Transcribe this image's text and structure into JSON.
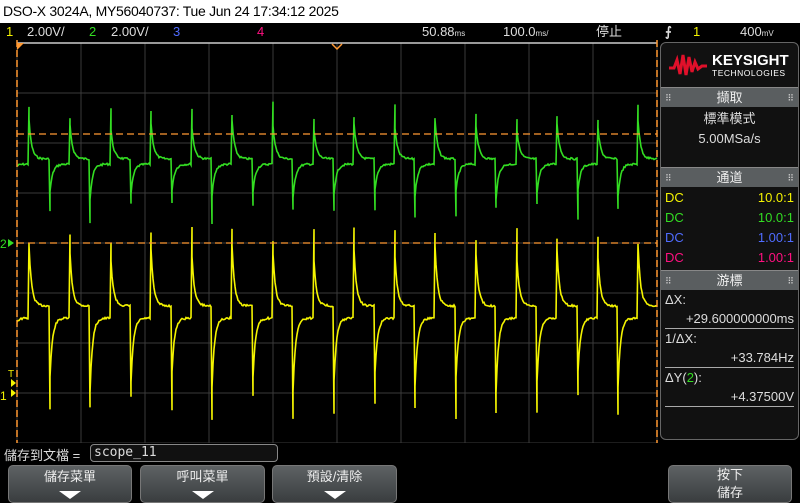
{
  "title": "DSO-X 3024A, MY56040737: Tue Jun 24 17:34:12 2025",
  "channels": [
    {
      "num": "1",
      "scale": "2.00V/",
      "color": "#f4f400"
    },
    {
      "num": "2",
      "scale": "2.00V/",
      "color": "#33dd22"
    },
    {
      "num": "3",
      "scale": "",
      "color": "#4f6cff"
    },
    {
      "num": "4",
      "scale": "",
      "color": "#ff1080"
    }
  ],
  "timebase": {
    "delay": "50.88",
    "delay_unit": "ms",
    "scale": "100.0",
    "scale_unit": "ms/",
    "run_state": "停止"
  },
  "trigger": {
    "slope_icon": "rising-edge-icon",
    "source": "1",
    "level": "400",
    "level_unit": "mV"
  },
  "panel": {
    "brand": "KEYSIGHT",
    "brand_sub": "TECHNOLOGIES",
    "acquire": {
      "header": "擷取",
      "mode": "標準模式",
      "rate": "5.00MSa/s"
    },
    "channels": {
      "header": "通道",
      "rows": [
        {
          "coupling": "DC",
          "probe": "10.0:1",
          "color": "#f4f400"
        },
        {
          "coupling": "DC",
          "probe": "10.0:1",
          "color": "#33dd22"
        },
        {
          "coupling": "DC",
          "probe": "1.00:1",
          "color": "#4f6cff"
        },
        {
          "coupling": "DC",
          "probe": "1.00:1",
          "color": "#ff1080"
        }
      ]
    },
    "cursors": {
      "header": "游標",
      "dx_label": "ΔX:",
      "dx": "+29.600000000ms",
      "inv_label": "1/ΔX:",
      "inv": "+33.784Hz",
      "dy_label_pre": "ΔY(",
      "dy_src": "2",
      "dy_label_post": "):",
      "dy": "+4.37500V"
    }
  },
  "markers": {
    "ch2": "2",
    "ch1": "1",
    "trig": "T"
  },
  "bottom": {
    "save_label": "儲存到文檔 =",
    "filename": "scope_11",
    "buttons": [
      "儲存菜單",
      "呼叫菜單",
      "預設/清除"
    ],
    "press_line1": "按下",
    "press_line2": "儲存"
  }
}
